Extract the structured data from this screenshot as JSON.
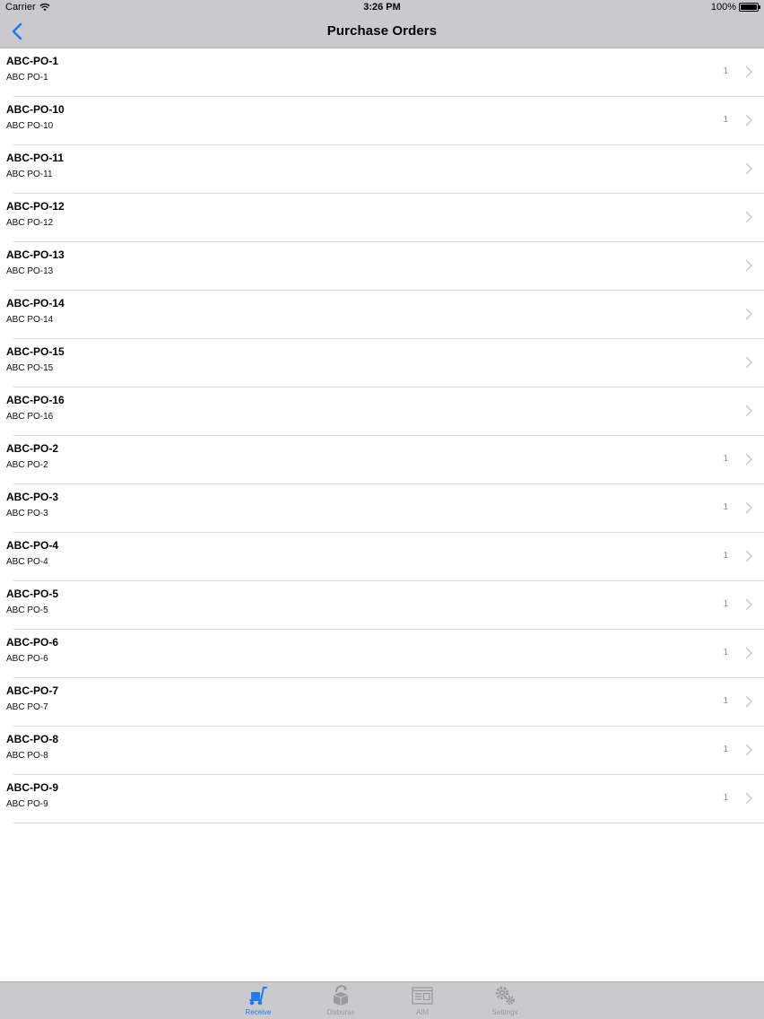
{
  "status_bar": {
    "carrier": "Carrier",
    "time": "3:26 PM",
    "battery": "100%",
    "battery_level": 1.0
  },
  "nav": {
    "title": "Purchase Orders",
    "back_icon": "chevron-left-icon"
  },
  "orders": [
    {
      "title": "ABC-PO-1",
      "subtitle": "ABC PO-1",
      "count": "1"
    },
    {
      "title": "ABC-PO-10",
      "subtitle": "ABC PO-10",
      "count": "1"
    },
    {
      "title": "ABC-PO-11",
      "subtitle": "ABC PO-11",
      "count": ""
    },
    {
      "title": "ABC-PO-12",
      "subtitle": "ABC PO-12",
      "count": ""
    },
    {
      "title": "ABC-PO-13",
      "subtitle": "ABC PO-13",
      "count": ""
    },
    {
      "title": "ABC-PO-14",
      "subtitle": "ABC PO-14",
      "count": ""
    },
    {
      "title": "ABC-PO-15",
      "subtitle": "ABC PO-15",
      "count": ""
    },
    {
      "title": "ABC-PO-16",
      "subtitle": "ABC PO-16",
      "count": ""
    },
    {
      "title": "ABC-PO-2",
      "subtitle": "ABC PO-2",
      "count": "1"
    },
    {
      "title": "ABC-PO-3",
      "subtitle": "ABC PO-3",
      "count": "1"
    },
    {
      "title": "ABC-PO-4",
      "subtitle": "ABC PO-4",
      "count": "1"
    },
    {
      "title": "ABC-PO-5",
      "subtitle": "ABC PO-5",
      "count": "1"
    },
    {
      "title": "ABC-PO-6",
      "subtitle": "ABC PO-6",
      "count": "1"
    },
    {
      "title": "ABC-PO-7",
      "subtitle": "ABC PO-7",
      "count": "1"
    },
    {
      "title": "ABC-PO-8",
      "subtitle": "ABC PO-8",
      "count": "1"
    },
    {
      "title": "ABC-PO-9",
      "subtitle": "ABC PO-9",
      "count": "1"
    }
  ],
  "tab_bar": {
    "tabs": [
      {
        "label": "Receive",
        "icon": "hand-truck-icon",
        "active": true
      },
      {
        "label": "Disburse",
        "icon": "box-arrow-icon",
        "active": false
      },
      {
        "label": "AIM",
        "icon": "window-list-icon",
        "active": false
      },
      {
        "label": "Settings",
        "icon": "gears-icon",
        "active": false
      }
    ]
  },
  "colors": {
    "accent": "#1e7cf2",
    "bar_background": "#c9c9ce",
    "separator": "#d9d9dd",
    "inactive_tab": "#9a9a9e"
  }
}
